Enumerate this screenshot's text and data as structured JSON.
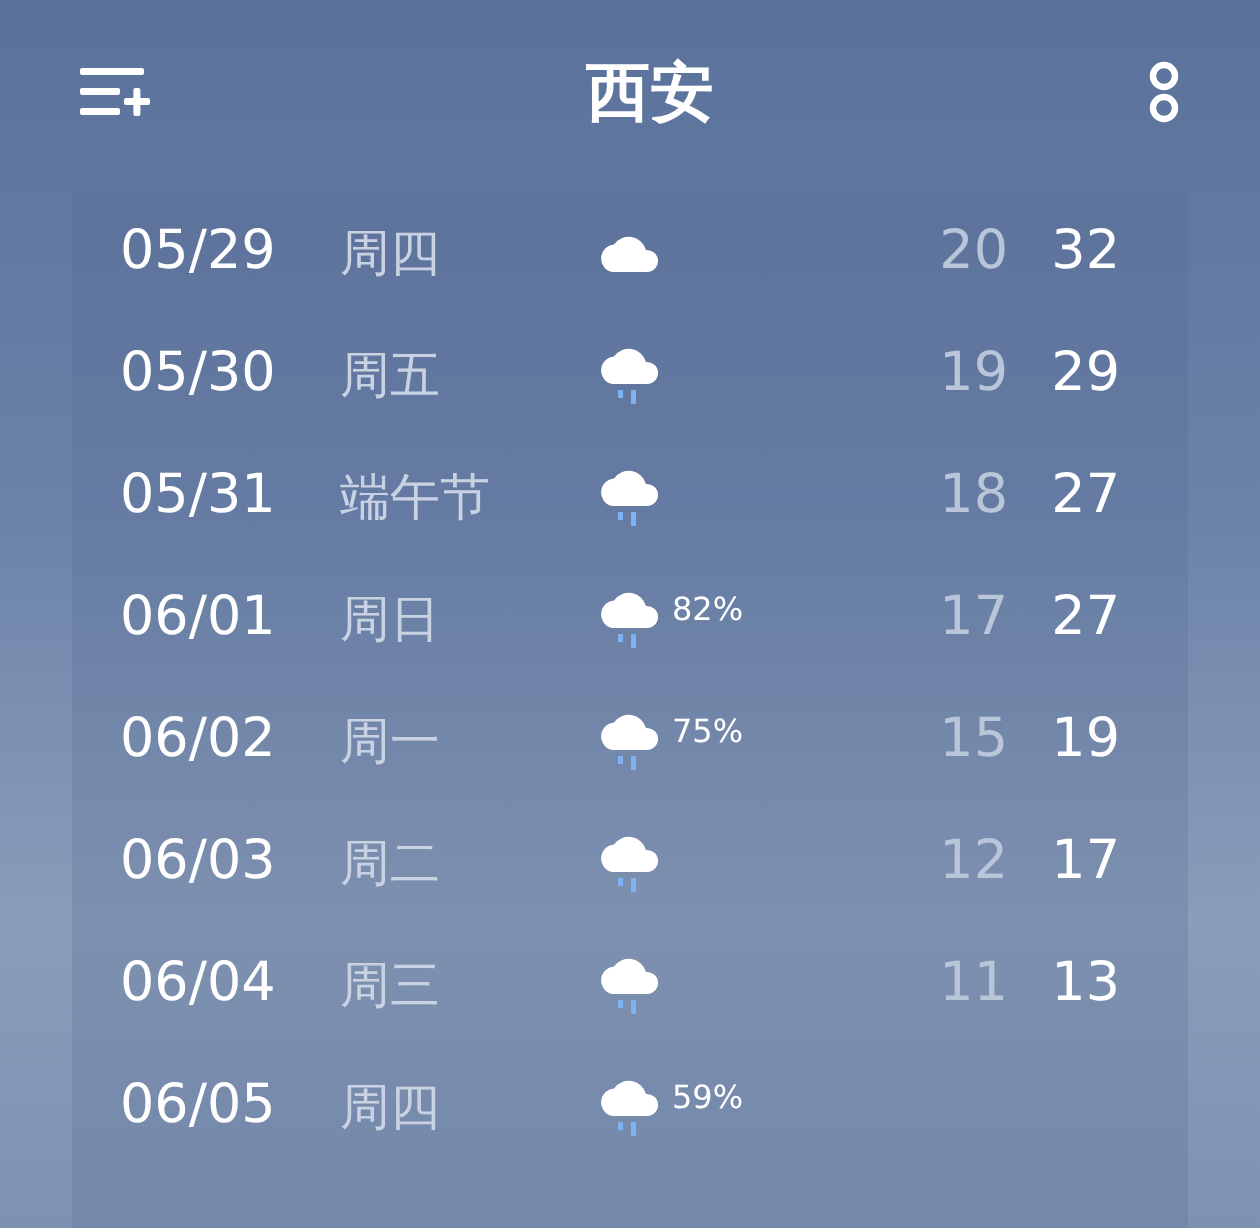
{
  "header": {
    "title": "西安"
  },
  "forecast": [
    {
      "date": "05/29",
      "weekday": "周四",
      "kind": "cloudy",
      "low": "20",
      "high": "32"
    },
    {
      "date": "05/30",
      "weekday": "周五",
      "kind": "rain",
      "low": "19",
      "high": "29"
    },
    {
      "date": "05/31",
      "weekday": "端午节",
      "kind": "rain",
      "low": "18",
      "high": "27"
    },
    {
      "date": "06/01",
      "weekday": "周日",
      "kind": "rain",
      "precip": "82%",
      "low": "17",
      "high": "27"
    },
    {
      "date": "06/02",
      "weekday": "周一",
      "kind": "rain",
      "precip": "75%",
      "low": "15",
      "high": "19"
    },
    {
      "date": "06/03",
      "weekday": "周二",
      "kind": "rain",
      "low": "12",
      "high": "17"
    },
    {
      "date": "06/04",
      "weekday": "周三",
      "kind": "rain",
      "low": "11",
      "high": "13"
    },
    {
      "date": "06/05",
      "weekday": "周四",
      "kind": "rain",
      "precip": "59%"
    }
  ]
}
